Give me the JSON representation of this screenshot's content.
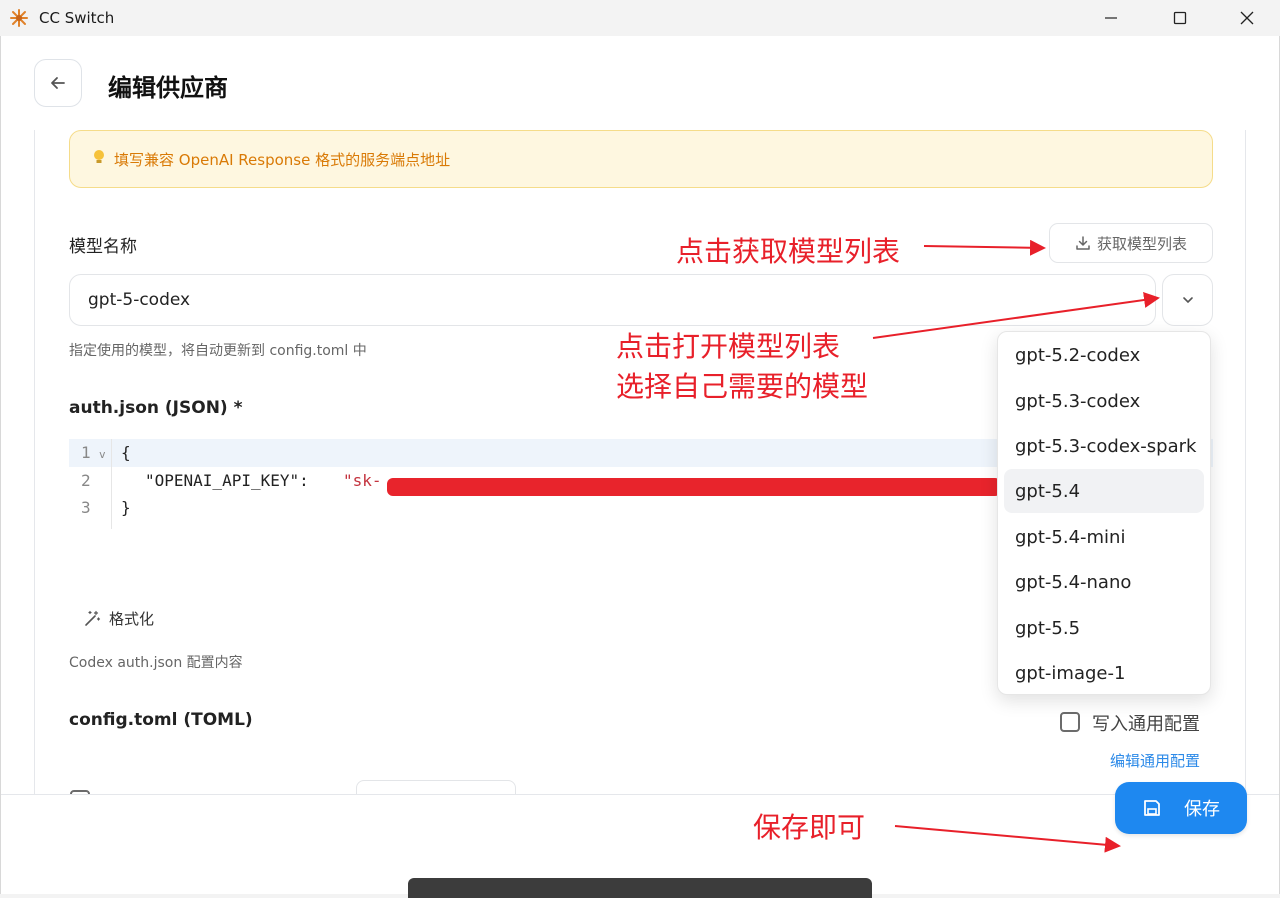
{
  "window": {
    "title": "CC Switch"
  },
  "header": {
    "title": "编辑供应商"
  },
  "hint": {
    "text": "填写兼容 OpenAI Response 格式的服务端点地址"
  },
  "model": {
    "label": "模型名称",
    "fetch_label": "获取模型列表",
    "value": "gpt-5-codex",
    "helper": "指定使用的模型，将自动更新到 config.toml 中",
    "options": [
      "gpt-5.2-codex",
      "gpt-5.3-codex",
      "gpt-5.3-codex-spark",
      "gpt-5.4",
      "gpt-5.4-mini",
      "gpt-5.4-nano",
      "gpt-5.5",
      "gpt-image-1"
    ],
    "highlighted": "gpt-5.4"
  },
  "auth": {
    "label": "auth.json (JSON) *",
    "lines": [
      "1",
      "2",
      "3"
    ],
    "code_open": "{",
    "key": "\"OPENAI_API_KEY\": ",
    "value_prefix": "\"sk-",
    "code_close": "}",
    "format_label": "格式化",
    "helper": "Codex auth.json 配置内容"
  },
  "config": {
    "label": "config.toml (TOML)",
    "write_common_label": "写入通用配置",
    "write_common_checked": false,
    "edit_common_label": "编辑通用配置"
  },
  "footer": {
    "save_label": "保存"
  },
  "annotations": {
    "fetch": "点击获取模型列表",
    "open_line1": "点击打开模型列表",
    "open_line2": "选择自己需要的模型",
    "save": "保存即可"
  },
  "colors": {
    "accent": "#1e88f0",
    "annotation": "#e8202a",
    "hint_text": "#d97a06"
  }
}
